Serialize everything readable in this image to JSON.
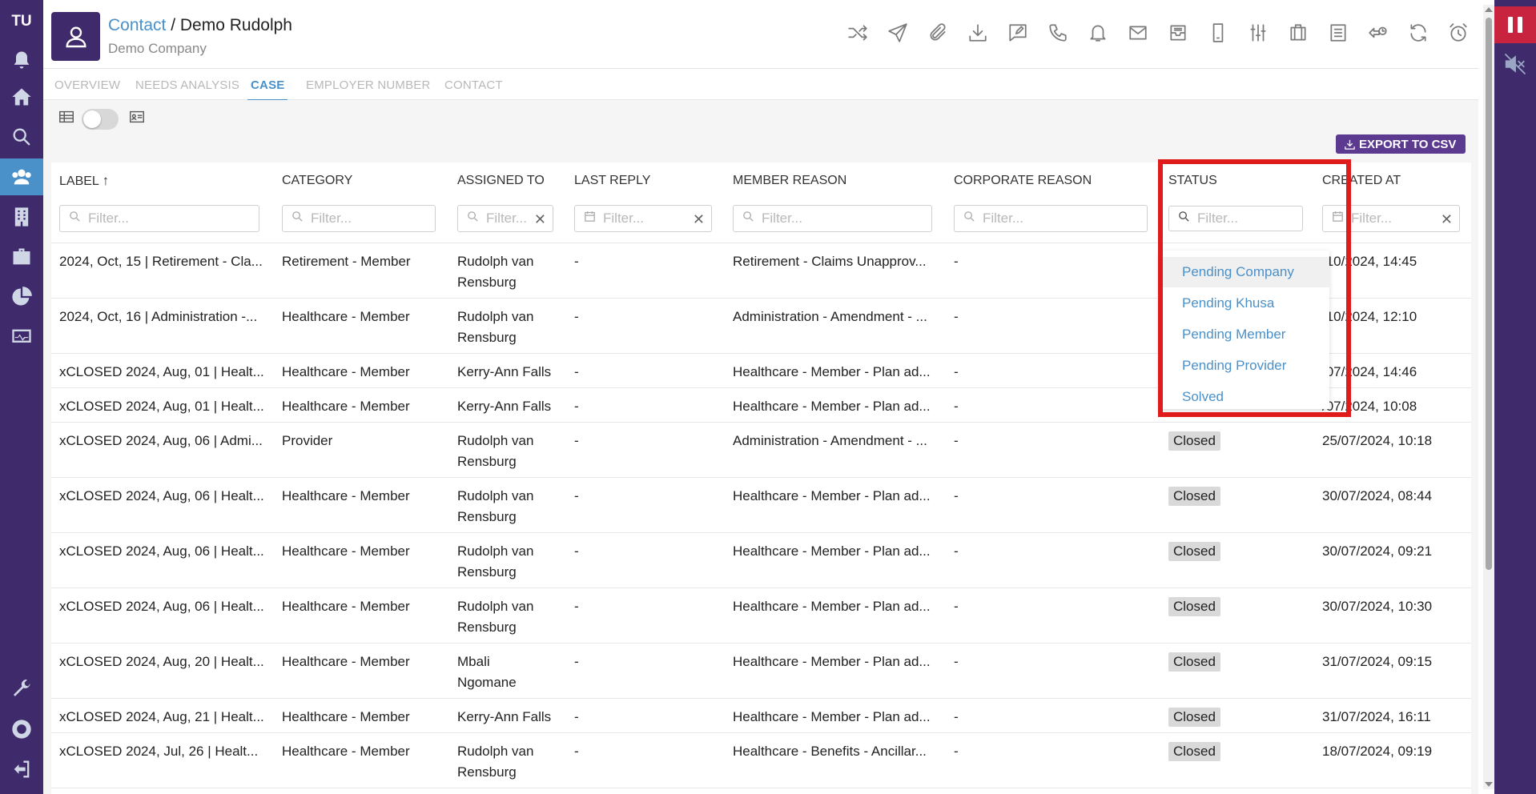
{
  "sidebar": {
    "initials": "TU",
    "items": [
      {
        "name": "notifications-icon"
      },
      {
        "name": "home-icon"
      },
      {
        "name": "search-icon"
      },
      {
        "name": "contacts-icon",
        "active": true
      },
      {
        "name": "company-icon"
      },
      {
        "name": "cases-icon"
      },
      {
        "name": "reports-icon"
      },
      {
        "name": "monitor-icon"
      },
      {
        "name": "tools-icon"
      },
      {
        "name": "help-icon"
      },
      {
        "name": "logout-icon"
      }
    ]
  },
  "header": {
    "breadcrumb_link": "Contact",
    "breadcrumb_sep": " / ",
    "breadcrumb_current": "Demo Rudolph",
    "subtitle": "Demo Company",
    "toolbar_icons": [
      "transfer-icon",
      "send-icon",
      "attach-icon",
      "download-icon",
      "note-icon",
      "phone-icon",
      "bell-icon",
      "mail-icon",
      "inbox-icon",
      "mobile-icon",
      "settings-sliders-icon",
      "briefcase-icon",
      "list-icon",
      "callback-icon",
      "refresh-icon",
      "alarm-icon"
    ]
  },
  "tabs": [
    {
      "label": "OVERVIEW",
      "active": false
    },
    {
      "label": "NEEDS ANALYSIS",
      "active": false
    },
    {
      "label": "CASE",
      "active": true
    },
    {
      "label": "EMPLOYER NUMBER",
      "active": false
    },
    {
      "label": "CONTACT",
      "active": false
    }
  ],
  "export_label": "EXPORT TO CSV",
  "table": {
    "columns": [
      "LABEL",
      "CATEGORY",
      "ASSIGNED TO",
      "LAST REPLY",
      "MEMBER REASON",
      "CORPORATE REASON",
      "STATUS",
      "CREATED AT"
    ],
    "sort_indicator": "↑",
    "filter_placeholder": "Filter...",
    "rows": [
      {
        "label": "2024, Oct, 15 | Retirement - Cla...",
        "category": "Retirement - Member",
        "assigned_line1": "Rudolph van",
        "assigned_line2": "Rensburg",
        "last_reply": "-",
        "member_reason": "Retirement - Claims Unapprov...",
        "corporate_reason": "-",
        "status": "",
        "created": "/10/2024, 14:45"
      },
      {
        "label": "2024, Oct, 16 | Administration -...",
        "category": "Healthcare - Member",
        "assigned_line1": "Rudolph van",
        "assigned_line2": "Rensburg",
        "last_reply": "-",
        "member_reason": "Administration - Amendment - ...",
        "corporate_reason": "-",
        "status": "",
        "created": "/10/2024, 12:10"
      },
      {
        "label": "xCLOSED 2024, Aug, 01 | Healt...",
        "category": "Healthcare - Member",
        "assigned_line1": "Kerry-Ann Falls",
        "assigned_line2": "",
        "last_reply": "-",
        "member_reason": "Healthcare - Member - Plan ad...",
        "corporate_reason": "-",
        "status": "",
        "created": "/07/2024, 14:46"
      },
      {
        "label": "xCLOSED 2024, Aug, 01 | Healt...",
        "category": "Healthcare - Member",
        "assigned_line1": "Kerry-Ann Falls",
        "assigned_line2": "",
        "last_reply": "-",
        "member_reason": "Healthcare - Member - Plan ad...",
        "corporate_reason": "-",
        "status": "",
        "created": "/07/2024, 10:08"
      },
      {
        "label": "xCLOSED 2024, Aug, 06 | Admi...",
        "category": "Provider",
        "assigned_line1": "Rudolph van",
        "assigned_line2": "Rensburg",
        "last_reply": "-",
        "member_reason": "Administration - Amendment - ...",
        "corporate_reason": "-",
        "status": "Closed",
        "created": "25/07/2024, 10:18"
      },
      {
        "label": "xCLOSED 2024, Aug, 06 | Healt...",
        "category": "Healthcare - Member",
        "assigned_line1": "Rudolph van",
        "assigned_line2": "Rensburg",
        "last_reply": "-",
        "member_reason": "Healthcare - Member - Plan ad...",
        "corporate_reason": "-",
        "status": "Closed",
        "created": "30/07/2024, 08:44"
      },
      {
        "label": "xCLOSED 2024, Aug, 06 | Healt...",
        "category": "Healthcare - Member",
        "assigned_line1": "Rudolph van",
        "assigned_line2": "Rensburg",
        "last_reply": "-",
        "member_reason": "Healthcare - Member - Plan ad...",
        "corporate_reason": "-",
        "status": "Closed",
        "created": "30/07/2024, 09:21"
      },
      {
        "label": "xCLOSED 2024, Aug, 06 | Healt...",
        "category": "Healthcare - Member",
        "assigned_line1": "Rudolph van",
        "assigned_line2": "Rensburg",
        "last_reply": "-",
        "member_reason": "Healthcare - Member - Plan ad...",
        "corporate_reason": "-",
        "status": "Closed",
        "created": "30/07/2024, 10:30"
      },
      {
        "label": "xCLOSED 2024, Aug, 20 | Healt...",
        "category": "Healthcare - Member",
        "assigned_line1": "Mbali",
        "assigned_line2": "Ngomane",
        "last_reply": "-",
        "member_reason": "Healthcare - Member - Plan ad...",
        "corporate_reason": "-",
        "status": "Closed",
        "created": "31/07/2024, 09:15"
      },
      {
        "label": "xCLOSED 2024, Aug, 21 | Healt...",
        "category": "Healthcare - Member",
        "assigned_line1": "Kerry-Ann Falls",
        "assigned_line2": "",
        "last_reply": "-",
        "member_reason": "Healthcare - Member - Plan ad...",
        "corporate_reason": "-",
        "status": "Closed",
        "created": "31/07/2024, 16:11"
      },
      {
        "label": "xCLOSED 2024, Jul, 26 | Healt...",
        "category": "Healthcare - Member",
        "assigned_line1": "Rudolph van",
        "assigned_line2": "Rensburg",
        "last_reply": "-",
        "member_reason": "Healthcare - Benefits - Ancillar...",
        "corporate_reason": "-",
        "status": "Closed",
        "created": "18/07/2024, 09:19"
      }
    ]
  },
  "status_dropdown": {
    "options": [
      "Pending Company",
      "Pending Khusa",
      "Pending Member",
      "Pending Provider",
      "Solved"
    ]
  },
  "colors": {
    "sidebar": "#3f2a6b",
    "accent": "#4a90c9",
    "export_button": "#5b3a8f",
    "highlight": "#e01b1b",
    "pause": "#c9243f"
  }
}
